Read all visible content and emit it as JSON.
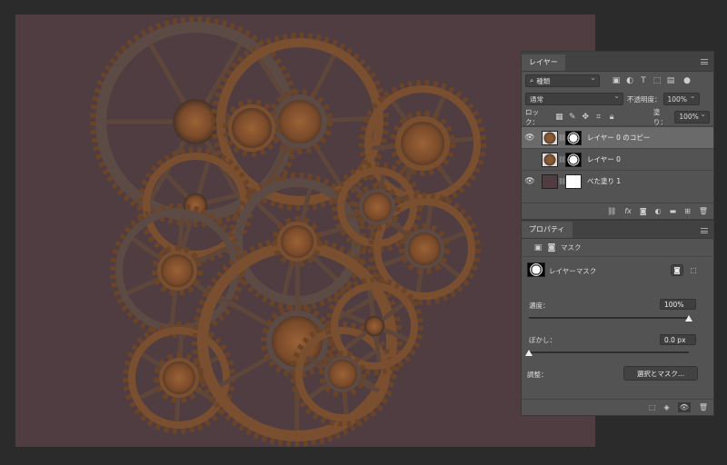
{
  "panel": {
    "close_glyph": "×",
    "layers_tab": "レイヤー",
    "kind_filter": "種類",
    "blend_mode": "通常",
    "opacity_label": "不透明度：",
    "opacity_value": "100%",
    "lock_label": "ロック：",
    "fill_label": "塗り：",
    "fill_value": "100%",
    "layers": [
      {
        "name": "レイヤー 0 のコピー",
        "visible": true,
        "selected": true
      },
      {
        "name": "レイヤー 0",
        "visible": false,
        "selected": false
      },
      {
        "name": "べた塗り 1",
        "visible": true,
        "selected": false
      }
    ],
    "layers_footer_icons": [
      "link-icon",
      "fx-icon",
      "mask-icon",
      "adjustment-icon",
      "folder-icon",
      "new-layer-icon",
      "trash-icon"
    ],
    "fx_label": "fx"
  },
  "properties": {
    "tab": "プロパティ",
    "mask_header": "マスク",
    "layer_mask_label": "レイヤーマスク",
    "density_label": "濃度：",
    "density_value": "100%",
    "density_level": 1.0,
    "feather_label": "ぼかし：",
    "feather_value": "0.0 px",
    "feather_level": 0.0,
    "refine_label": "調整：",
    "select_mask_button": "選択とマスク..."
  },
  "colors": {
    "canvas_bg": "#4f3d41",
    "panel_bg": "#535353",
    "rust": "#8a5a32"
  }
}
